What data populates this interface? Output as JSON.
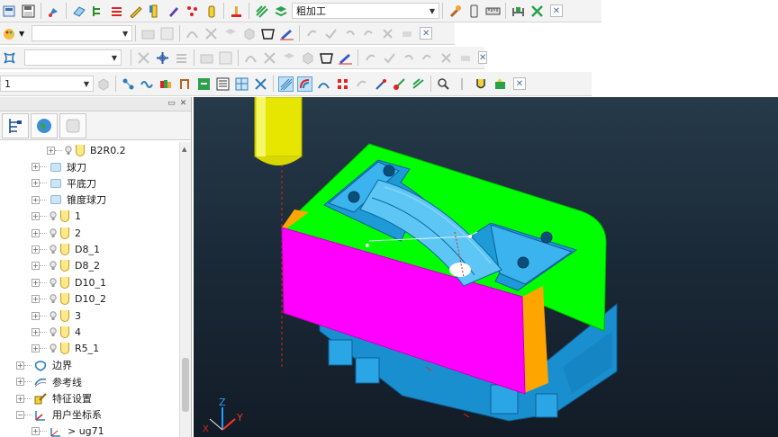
{
  "toolbar1": {
    "operation_combo_value": "粗加工",
    "icons": [
      "open-icon",
      "save-icon",
      "paint-icon",
      "mesh-icon",
      "tree-icon",
      "level-icon",
      "pencil-icon",
      "tool-icon",
      "pen-icon",
      "scatter-icon",
      "bottle-icon",
      "stock-icon",
      "stripes-icon",
      "stack-icon",
      "wrench-icon",
      "device-icon",
      "ruler-icon",
      "bed-icon",
      "tools-icon"
    ]
  },
  "toolbar2": {
    "combo_value": ""
  },
  "toolbar3": {
    "combo_value": ""
  },
  "toolbar4": {
    "combo_value": "1"
  },
  "panel": {
    "tree_items": [
      {
        "label": "B2R0.2",
        "kind": "tool",
        "indent": 2
      },
      {
        "label": "球刀",
        "kind": "folder",
        "indent": 1
      },
      {
        "label": "平底刀",
        "kind": "folder",
        "indent": 1
      },
      {
        "label": "锥度球刀",
        "kind": "folder",
        "indent": 1
      },
      {
        "label": "1",
        "kind": "tool",
        "indent": 1
      },
      {
        "label": "2",
        "kind": "tool",
        "indent": 1
      },
      {
        "label": "D8_1",
        "kind": "tool",
        "indent": 1
      },
      {
        "label": "D8_2",
        "kind": "tool",
        "indent": 1
      },
      {
        "label": "D10_1",
        "kind": "tool",
        "indent": 1
      },
      {
        "label": "D10_2",
        "kind": "tool",
        "indent": 1
      },
      {
        "label": "3",
        "kind": "tool",
        "indent": 1
      },
      {
        "label": "4",
        "kind": "tool",
        "indent": 1
      },
      {
        "label": "R5_1",
        "kind": "tool",
        "indent": 1
      },
      {
        "label": "边界",
        "kind": "boundary",
        "indent": 0
      },
      {
        "label": "参考线",
        "kind": "refline",
        "indent": 0
      },
      {
        "label": "特征设置",
        "kind": "feature",
        "indent": 0
      },
      {
        "label": "用户坐标系",
        "kind": "ucs",
        "indent": 0,
        "expanded": true
      },
      {
        "label": "> ug71",
        "kind": "ucsitem",
        "indent": 1
      }
    ]
  },
  "viewport": {
    "axes": {
      "z": "Z",
      "y": "Y",
      "x": "X"
    },
    "colors": {
      "background_top": "#263a4a",
      "part": "#1e9ad6",
      "block_side": "#ff00ff",
      "block_top": "#00ff00",
      "corner": "#ffa500",
      "tool": "#e6e600"
    }
  }
}
